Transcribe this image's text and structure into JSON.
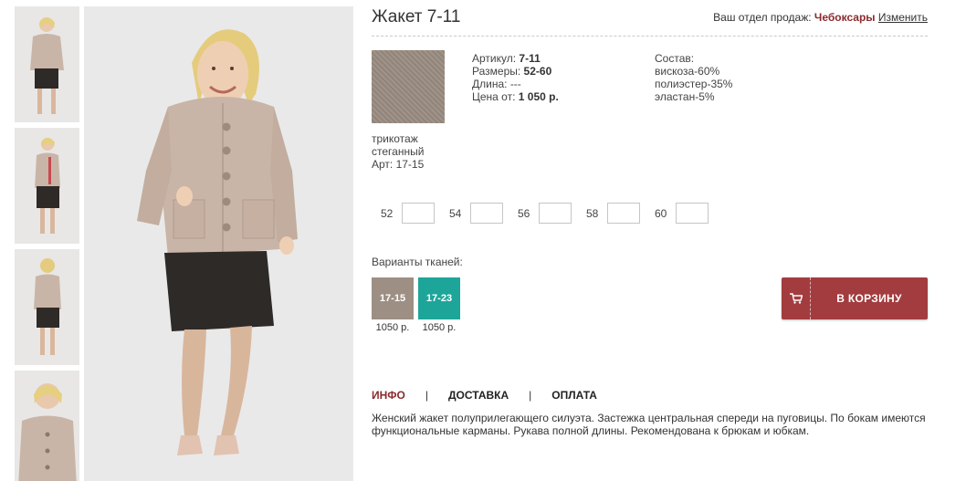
{
  "product": {
    "title": "Жакет 7-11",
    "article_label": "Артикул:",
    "article_value": "7-11",
    "sizes_label": "Размеры:",
    "sizes_value": "52-60",
    "length_label": "Длина:",
    "length_value": "---",
    "price_label": "Цена от:",
    "price_value": "1 050 р."
  },
  "sales_dept": {
    "label": "Ваш отдел продаж:",
    "city": "Чебоксары",
    "change": "Изменить"
  },
  "fabric": {
    "line1": "трикотаж",
    "line2": "стеганный",
    "line3": "Арт: 17-15"
  },
  "composition": {
    "title": "Состав:",
    "items": [
      "вискоза-60%",
      "полиэстер-35%",
      "эластан-5%"
    ]
  },
  "sizes": [
    {
      "label": "52"
    },
    {
      "label": "54"
    },
    {
      "label": "56"
    },
    {
      "label": "58"
    },
    {
      "label": "60"
    }
  ],
  "variants": {
    "label": "Варианты тканей:",
    "items": [
      {
        "code": "17-15",
        "price": "1050 р.",
        "color": "#9d8f84"
      },
      {
        "code": "17-23",
        "price": "1050 р.",
        "color": "#1ea59a"
      }
    ]
  },
  "cart_button": {
    "label": "В КОРЗИНУ",
    "icon": "cart-icon",
    "color": "#a33c3f"
  },
  "tabs": {
    "info": "ИНФО",
    "delivery": "ДОСТАВКА",
    "payment": "ОПЛАТА",
    "separator": "|"
  },
  "description": "Женский жакет полуприлегающего силуэта. Застежка центральная спереди на пуговицы. По бокам имеются функциональные карманы. Рукава полной длины. Рекомендована к брюкам и юбкам.",
  "colors": {
    "accent": "#8b2a2d",
    "jacket": "#c9b5a7",
    "skirt": "#2e2a27"
  }
}
